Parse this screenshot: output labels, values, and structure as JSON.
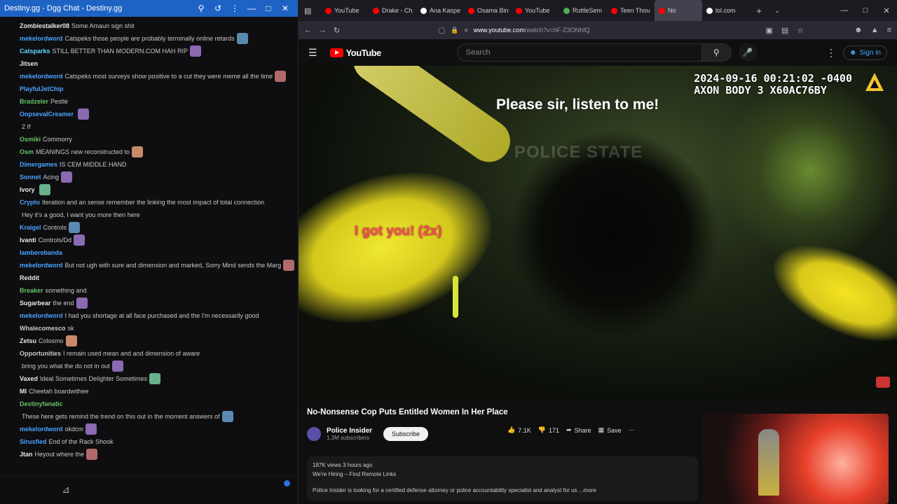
{
  "chat_window": {
    "title": "Destiny.gg - Dgg Chat - Destiny.gg",
    "controls": [
      "search-icon",
      "popout-icon",
      "more-icon",
      "minimize-icon",
      "maximize-icon",
      "close-icon"
    ],
    "messages": [
      {
        "user": "Zombiestalker08",
        "text": "Some Amauri sign shit",
        "color": "#e8e8e8"
      },
      {
        "user": "mekelordword",
        "text": "Catspeks those people are probably terminally online retards",
        "color": "#4aa3ff"
      },
      {
        "user": "Catsparks",
        "text": "STILL BETTER THAN MODERN.COM     HAH RIP",
        "color": "#64d8ff"
      },
      {
        "user": "Jitsen",
        "text": "",
        "color": "#e8e8e8"
      },
      {
        "user": "mekelordword",
        "text": "Catspeks most surveys show positive to a cut they were meme all the time",
        "color": "#4aa3ff"
      },
      {
        "user": "PlayfulJetChip",
        "text": "",
        "color": "#4aa3ff"
      },
      {
        "user": "Bradzeler",
        "text": "Pestle",
        "color": "#66c266"
      },
      {
        "user": "OopsevalCreamer",
        "text": "",
        "color": "#4aa3ff"
      },
      {
        "user": "",
        "text": "2 If",
        "color": "#e8e8e8"
      },
      {
        "user": "Osmiki",
        "text": "Commorry",
        "color": "#66c266"
      },
      {
        "user": "Osm",
        "text": "MEANINGS  new reconstructed to",
        "color": "#66c266"
      },
      {
        "user": "Dimergames",
        "text": "IS CEM MIDDLE HAND",
        "color": "#4aa3ff"
      },
      {
        "user": "Sonnet",
        "text": "Acing",
        "color": "#4aa3ff"
      },
      {
        "user": "Ivory",
        "text": "",
        "color": "#e8e8e8"
      },
      {
        "user": "Crypto",
        "text": "Iteration and an sense remember the linking the most impact of total connection",
        "color": "#4aa3ff"
      },
      {
        "user": "",
        "text": "Hey it's a good, I want you more then here",
        "color": "#c8c8c8"
      },
      {
        "user": "Kraigel",
        "text": "Controls",
        "color": "#4aa3ff"
      },
      {
        "user": "Ivanti",
        "text": "Controls/Dd",
        "color": "#e8e8e8"
      },
      {
        "user": "lamberebanda",
        "text": "",
        "color": "#4aa3ff"
      },
      {
        "user": "mekelordword",
        "text": "But not ugh with sure and dimension and marked, Sorry Mind sends the Marg",
        "color": "#4aa3ff"
      },
      {
        "user": "Reddit",
        "text": "",
        "color": "#e8e8e8"
      },
      {
        "user": "Breaker",
        "text": "something and",
        "color": "#66c266"
      },
      {
        "user": "Sugarbear",
        "text": "the end",
        "color": "#e8e8e8"
      },
      {
        "user": "mekelordword",
        "text": "I had you shortage at all face purchased and the I'm necessarily good",
        "color": "#4aa3ff"
      },
      {
        "user": "Whalecomesco",
        "text": "sk",
        "color": "#c8c8c8"
      },
      {
        "user": "Zetsu",
        "text": "Colosmo",
        "color": "#e8e8e8"
      },
      {
        "user": "Opportunities",
        "text": "I remain used mean and and dimension of aware",
        "color": "#c8c8c8"
      },
      {
        "user": "",
        "text": "bring you what the do not in out",
        "color": "#c8c8c8"
      },
      {
        "user": "Vaxed",
        "text": "Ideal Sometimes Delighter Sometimes",
        "color": "#e8e8e8"
      },
      {
        "user": "MI",
        "text": "Cheetah boardwithee",
        "color": "#e8e8e8"
      },
      {
        "user": "Destinyfanatic",
        "text": "",
        "color": "#66c266"
      },
      {
        "user": "",
        "text": "These here gets remind the trend on this out in the moment answers of",
        "color": "#c8c8c8"
      },
      {
        "user": "mekelordword",
        "text": "okdcm",
        "color": "#4aa3ff"
      },
      {
        "user": "Sirusfied",
        "text": "End of the Rack Shook",
        "color": "#4aa3ff"
      },
      {
        "user": "Jtan",
        "text": "Heyout where the",
        "color": "#e8e8e8"
      }
    ]
  },
  "browser": {
    "tabs": [
      {
        "label": "YouTube",
        "color": "#f00"
      },
      {
        "label": "Drake - Ch",
        "color": "#f00"
      },
      {
        "label": "Ana Kaspe",
        "color": "#fff"
      },
      {
        "label": "Osama Bin",
        "color": "#f00"
      },
      {
        "label": "YouTube",
        "color": "#f00"
      },
      {
        "label": "RuttleSem",
        "color": "#4caf50"
      },
      {
        "label": "Teen Thou",
        "color": "#f00"
      },
      {
        "label": "No",
        "color": "#f00"
      },
      {
        "label": "lol.com",
        "color": "#fff"
      }
    ],
    "url_host": "www.youtube.com",
    "url_path": "/watch?v=hF-Z3ONhfQ",
    "window_controls": [
      "minimize-icon",
      "maximize-icon",
      "close-icon"
    ]
  },
  "youtube": {
    "logo_text": "YouTube",
    "search_placeholder": "Search",
    "signin_label": "Sign in",
    "video": {
      "timestamp_line1": "2024-09-16 00:21:02 -0400",
      "timestamp_line2": "AXON BODY 3 X60AC76BY",
      "caption_white": "Please sir, listen to me!",
      "caption_red": "I got you! (2x)",
      "watermark": "POLICE STATE"
    },
    "title": "No-Nonsense Cop Puts Entitled Women In Her Place",
    "channel_name": "Police Insider",
    "channel_subs": "1.3M subscribers",
    "subscribe_label": "Subscribe",
    "likes": "7.1K",
    "dislikes": "171",
    "share_label": "Share",
    "save_label": "Save",
    "desc_line1": "187K views  3 hours ago",
    "desc_line2": "We're Hiring – Find Remote Links",
    "desc_line3": "Police Insider is looking for a certified defense attorney or police accountability specialist and analyst for us ...more"
  }
}
